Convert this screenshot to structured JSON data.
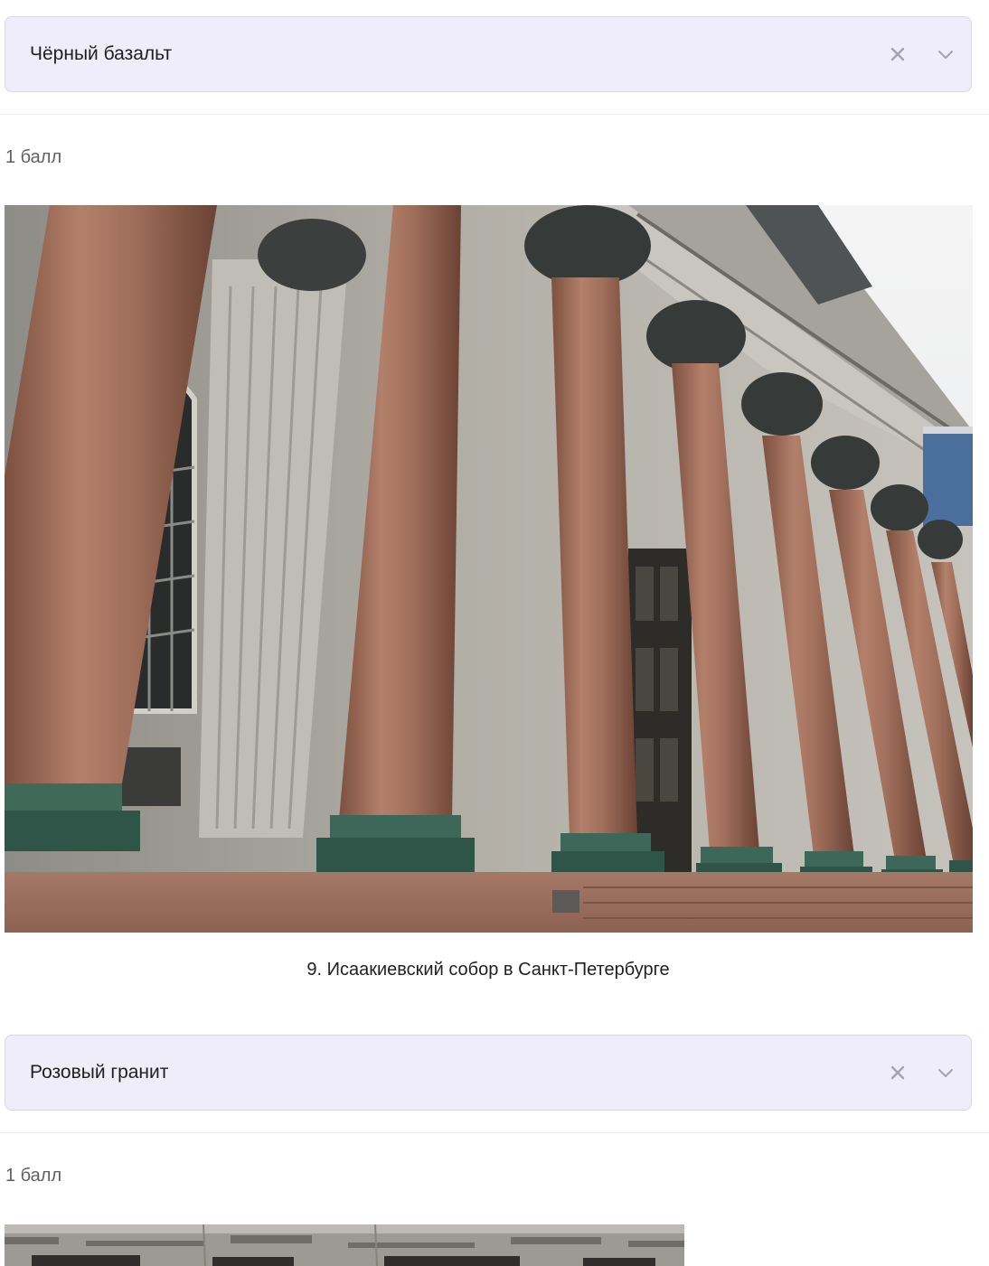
{
  "question8": {
    "select_value": "Чёрный базальт",
    "points": "1 балл"
  },
  "question9": {
    "caption": "9. Исаакиевский собор в Санкт-Петербурге",
    "select_value": "Розовый гранит",
    "points": "1 балл"
  },
  "icons": {
    "clear": "close-icon",
    "expand": "chevron-down-icon"
  },
  "colors": {
    "select_bg": "#efedf9",
    "select_border": "#d9d6ee",
    "divider": "#ecebf2",
    "muted_text": "#5f5f66"
  }
}
